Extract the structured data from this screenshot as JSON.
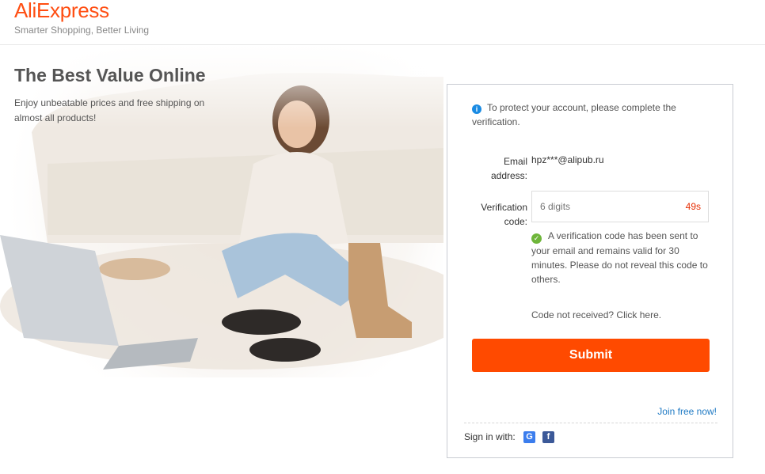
{
  "header": {
    "logo_text": "AliExpress",
    "tagline": "Smarter Shopping, Better Living"
  },
  "hero": {
    "title": "The Best Value Online",
    "subtitle": "Enjoy unbeatable prices and free shipping on almost all products!"
  },
  "panel": {
    "notice": "To protect your account, please complete the verification.",
    "email_label": "Email address:",
    "email_value": "hpz***@alipub.ru",
    "code_label": "Verification code:",
    "code_placeholder": "6 digits",
    "countdown": "49s",
    "sent_message": "A verification code has been sent to your email and remains valid for 30 minutes. Please do not reveal this code to others.",
    "resend_text": "Code not received? Click here.",
    "submit_label": "Submit",
    "join_text": "Join free now!",
    "signin_label": "Sign in with:",
    "social": [
      {
        "name": "google-icon",
        "glyph": "G"
      },
      {
        "name": "facebook-icon",
        "glyph": "f"
      }
    ]
  },
  "colors": {
    "brand": "#ff4e12",
    "submit": "#ff4a00",
    "countdown": "#e62e04",
    "link": "#1f7ac4",
    "info": "#1a8be3",
    "success": "#6fb63b"
  }
}
